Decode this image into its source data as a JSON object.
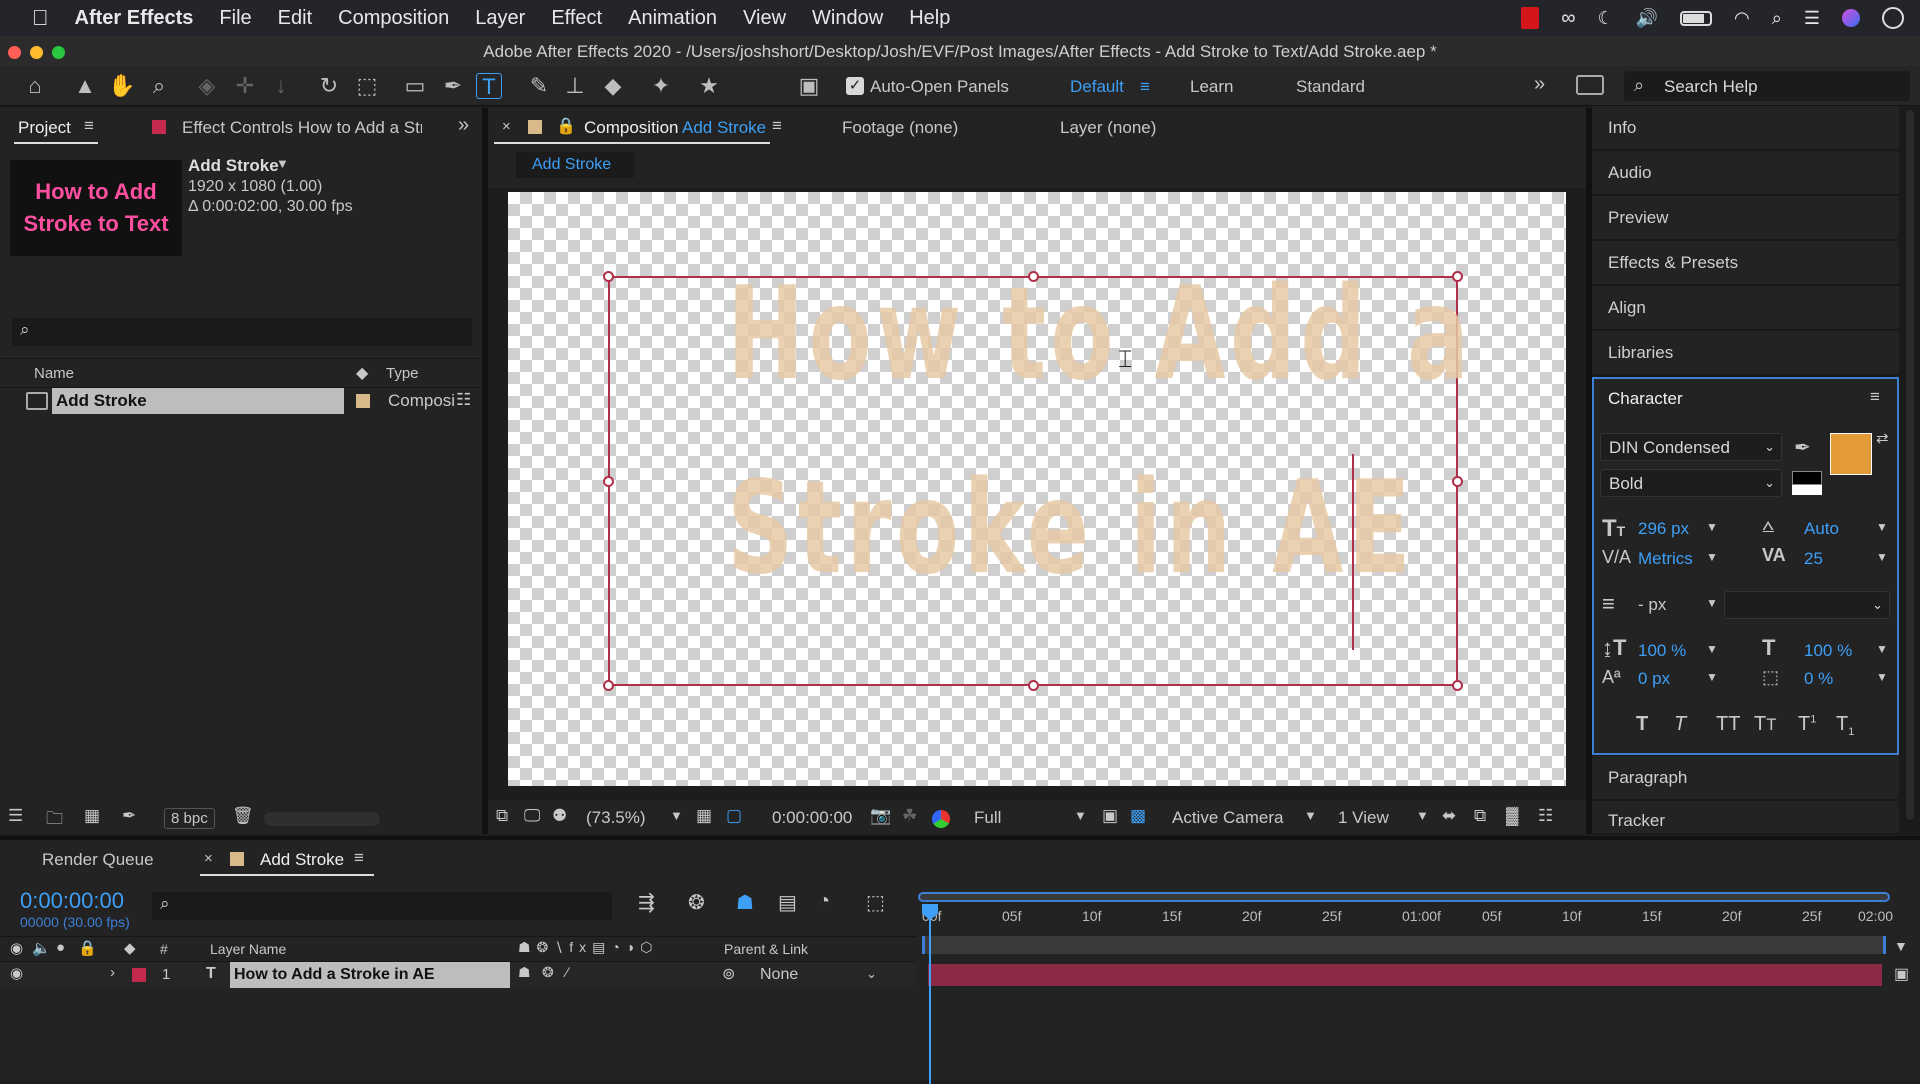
{
  "menubar": {
    "app": "After Effects",
    "items": [
      "File",
      "Edit",
      "Composition",
      "Layer",
      "Effect",
      "Animation",
      "View",
      "Window",
      "Help"
    ]
  },
  "window": {
    "title": "Adobe After Effects 2020 - /Users/joshshort/Desktop/Josh/EVF/Post Images/After Effects - Add Stroke to Text/Add Stroke.aep *"
  },
  "toolbar": {
    "auto_open": "Auto-Open Panels",
    "workspaces": [
      "Default",
      "Learn",
      "Standard"
    ],
    "search_placeholder": "Search Help"
  },
  "project": {
    "tab": "Project",
    "effect_controls": "Effect Controls How to Add a Stro",
    "thumb_text": "How to Add Stroke to Text",
    "comp_name": "Add Stroke",
    "comp_size": "1920 x 1080 (1.00)",
    "comp_dur": "Δ 0:00:02:00, 30.00 fps",
    "col_name": "Name",
    "col_type": "Type",
    "item_name": "Add Stroke",
    "item_type": "Composi",
    "bpc": "8 bpc"
  },
  "comp": {
    "tab_prefix": "Composition",
    "tab_name": "Add Stroke",
    "footage": "Footage (none)",
    "layer": "Layer (none)",
    "breadcrumb": "Add Stroke",
    "text_line1": "How to Add a",
    "text_line2": "Stroke in AE",
    "zoom": "(73.5%)",
    "timecode": "0:00:00:00",
    "resolution": "Full",
    "camera": "Active Camera",
    "views": "1 View"
  },
  "right": {
    "items": [
      "Info",
      "Audio",
      "Preview",
      "Effects & Presets",
      "Align",
      "Libraries"
    ],
    "items_bottom": [
      "Paragraph",
      "Tracker"
    ]
  },
  "character": {
    "title": "Character",
    "font": "DIN Condensed",
    "style": "Bold",
    "size": "296 px",
    "leading": "Auto",
    "kerning": "Metrics",
    "tracking": "25",
    "stroke": "- px",
    "vscale": "100 %",
    "hscale": "100 %",
    "baseline": "0 px",
    "tsume": "0 %",
    "fill_color": "#e39b3a"
  },
  "timeline": {
    "render_queue": "Render Queue",
    "tab": "Add Stroke",
    "timecode": "0:00:00:00",
    "frames": "00000 (30.00 fps)",
    "col_num": "#",
    "col_layer": "Layer Name",
    "col_parent": "Parent & Link",
    "layer_num": "1",
    "layer_name": "How to Add a Stroke in AE",
    "parent": "None",
    "ruler": [
      "00f",
      "05f",
      "10f",
      "15f",
      "20f",
      "25f",
      "01:00f",
      "05f",
      "10f",
      "15f",
      "20f",
      "25f",
      "02:00"
    ]
  }
}
